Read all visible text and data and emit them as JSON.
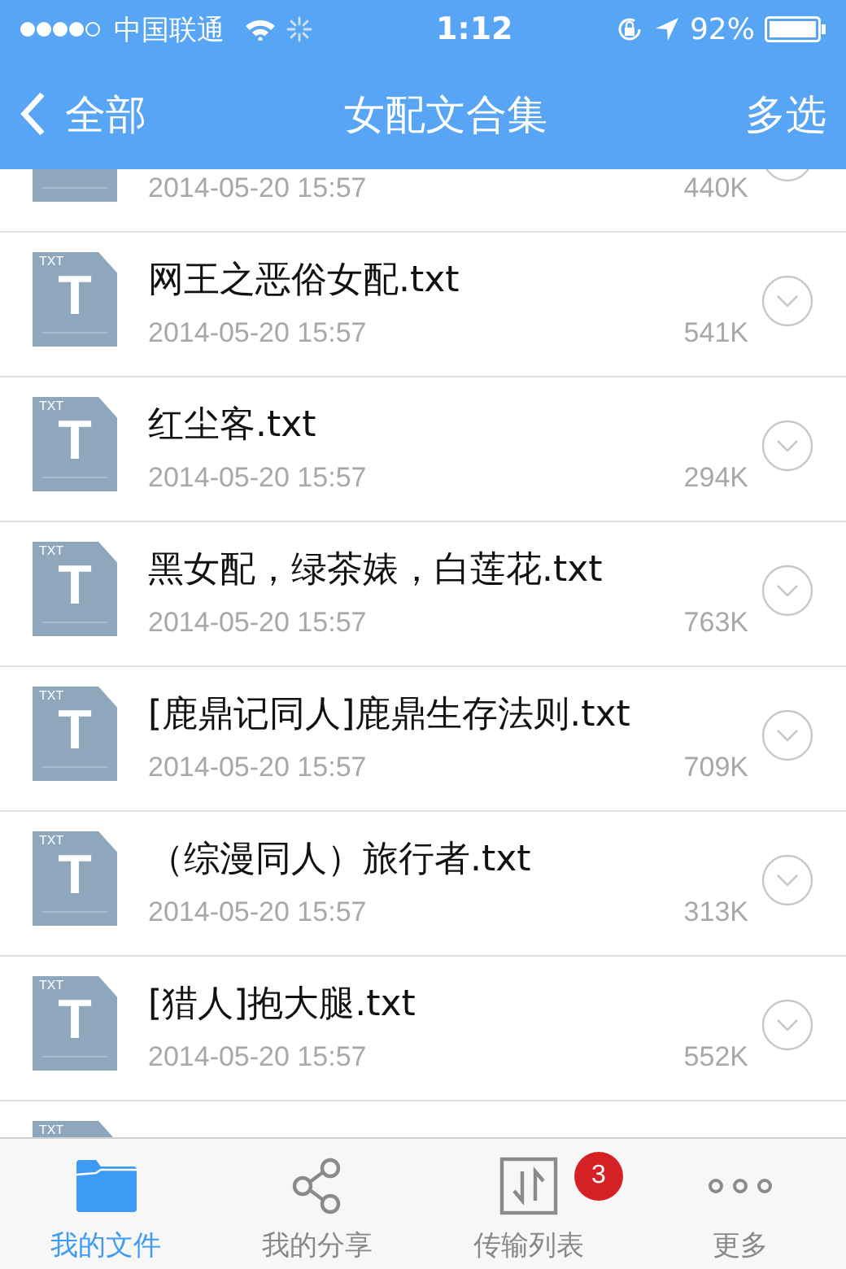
{
  "status_bar": {
    "carrier": "中国联通",
    "time": "1:12",
    "battery": "92%"
  },
  "nav": {
    "back": "全部",
    "title": "女配文合集",
    "action": "多选"
  },
  "files": [
    {
      "date": "2014-05-20 15:57",
      "size": "440K"
    },
    {
      "name": "网王之恶俗女配.txt",
      "date": "2014-05-20 15:57",
      "size": "541K",
      "type_label": "TXT",
      "type_letter": "T"
    },
    {
      "name": "红尘客.txt",
      "date": "2014-05-20 15:57",
      "size": "294K",
      "type_label": "TXT",
      "type_letter": "T"
    },
    {
      "name": "黑女配，绿茶婊，白莲花.txt",
      "date": "2014-05-20 15:57",
      "size": "763K",
      "type_label": "TXT",
      "type_letter": "T"
    },
    {
      "name": "[鹿鼎记同人]鹿鼎生存法则.txt",
      "date": "2014-05-20 15:57",
      "size": "709K",
      "type_label": "TXT",
      "type_letter": "T"
    },
    {
      "name": "（综漫同人）旅行者.txt",
      "date": "2014-05-20 15:57",
      "size": "313K",
      "type_label": "TXT",
      "type_letter": "T"
    },
    {
      "name": "[猎人]抱大腿.txt",
      "date": "2014-05-20 15:57",
      "size": "552K",
      "type_label": "TXT",
      "type_letter": "T"
    },
    {
      "type_label": "TXT"
    }
  ],
  "tabs": [
    {
      "label": "我的文件",
      "kind": "folder",
      "selected": true
    },
    {
      "label": "我的分享",
      "kind": "share",
      "selected": false
    },
    {
      "label": "传输列表",
      "kind": "transfer",
      "selected": false,
      "badge": "3"
    },
    {
      "label": "更多",
      "kind": "more",
      "selected": false
    }
  ]
}
